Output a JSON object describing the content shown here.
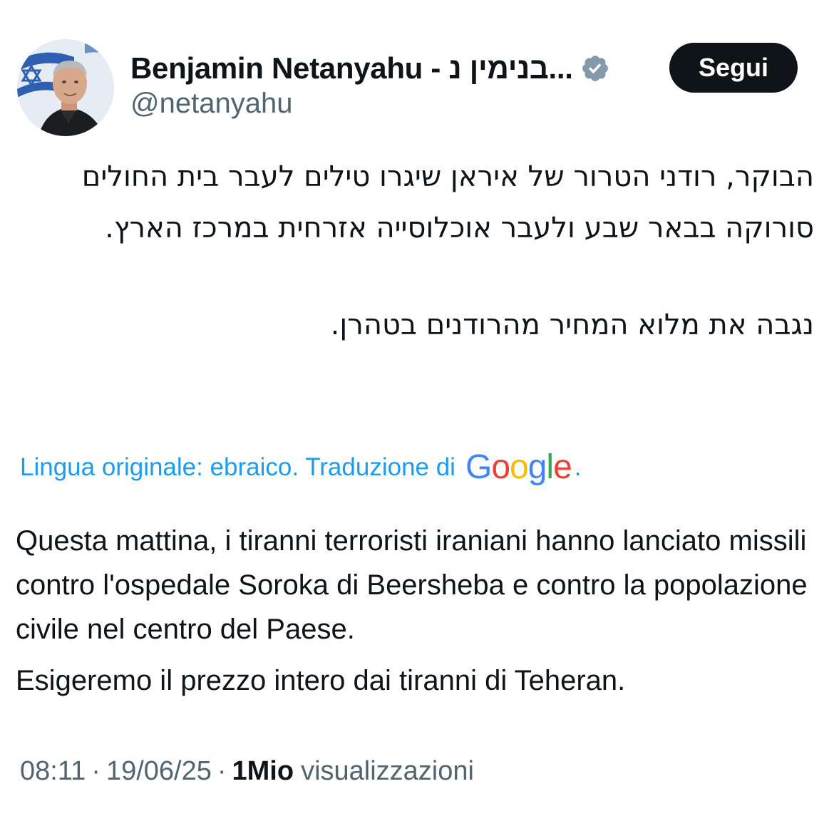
{
  "author": {
    "display_name": "Benjamin Netanyahu - בנימין נ...",
    "handle": "@netanyahu",
    "verified_icon": "verified-badge-icon"
  },
  "follow_button": {
    "label": "Segui"
  },
  "original_text": {
    "paragraphs": [
      "הבוקר, רודני הטרור של איראן שיגרו טילים לעבר בית החולים סורוקה בבאר שבע ולעבר אוכלוסייה אזרחית במרכז הארץ.",
      "נגבה את מלוא המחיר מהרודנים בטהרן."
    ]
  },
  "translation_note": {
    "text": "Lingua originale: ebraico. Traduzione di",
    "provider_letters": [
      "G",
      "o",
      "o",
      "g",
      "l",
      "e"
    ],
    "suffix": "."
  },
  "translated_text": {
    "paragraphs": [
      "Questa mattina, i tiranni terroristi iraniani hanno lanciato missili contro l'ospedale Soroka di Beersheba e contro la popolazione civile nel centro del Paese.",
      "Esigeremo il prezzo intero dai tiranni di Teheran."
    ]
  },
  "meta": {
    "time": "08:11",
    "separator": "·",
    "date": "19/06/25",
    "views_count": "1Mio",
    "views_label": "visualizzazioni"
  },
  "colors": {
    "link_blue": "#1d9bf0",
    "secondary_text": "#536471",
    "primary_text": "#0f1419",
    "verified_badge": "#829aab",
    "button_bg": "#0f1419"
  }
}
